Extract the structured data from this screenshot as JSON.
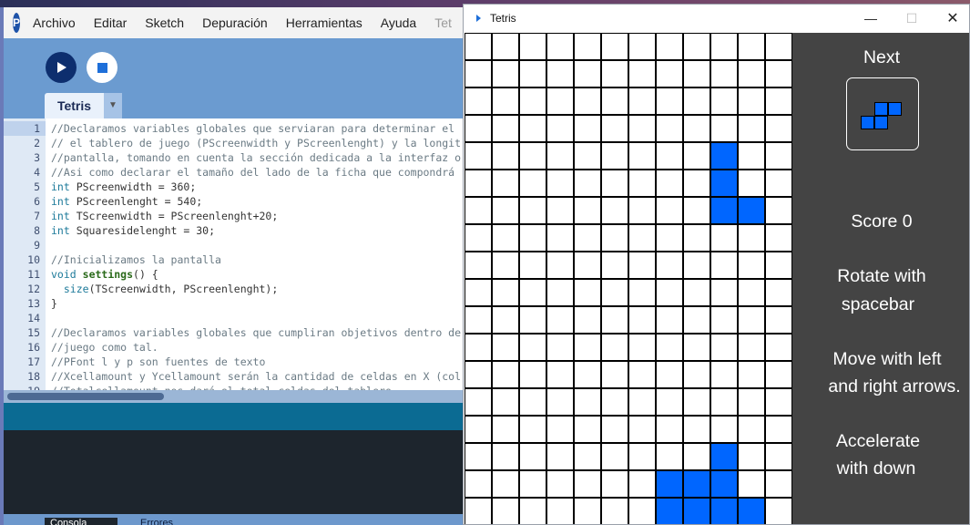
{
  "ide": {
    "menu": [
      "Archivo",
      "Editar",
      "Sketch",
      "Depuración",
      "Herramientas",
      "Ayuda",
      "Tet"
    ],
    "tab_label": "Tetris",
    "tab_arrow": "▼",
    "code_lines": [
      {
        "n": "1",
        "text": "//Declaramos variables globales que serviaran para determinar el"
      },
      {
        "n": "2",
        "text": "// el tablero de juego (PScreenwidth y PScreenlenght) y la longit"
      },
      {
        "n": "3",
        "text": "//pantalla, tomando en cuenta la sección dedicada a la interfaz o"
      },
      {
        "n": "4",
        "text": "//Asi como declarar el tamaño del lado de la ficha que compondrá"
      },
      {
        "n": "5",
        "text": "int PScreenwidth = 360;"
      },
      {
        "n": "6",
        "text": "int PScreenlenght = 540;"
      },
      {
        "n": "7",
        "text": "int TScreenwidth = PScreenlenght+20;"
      },
      {
        "n": "8",
        "text": "int Squaresidelenght = 30;"
      },
      {
        "n": "9",
        "text": ""
      },
      {
        "n": "10",
        "text": "//Inicializamos la pantalla"
      },
      {
        "n": "11",
        "text": "void settings() {"
      },
      {
        "n": "12",
        "text": "  size(TScreenwidth, PScreenlenght);"
      },
      {
        "n": "13",
        "text": "}"
      },
      {
        "n": "14",
        "text": ""
      },
      {
        "n": "15",
        "text": "//Declaramos variables globales que cumpliran objetivos dentro de"
      },
      {
        "n": "16",
        "text": "//juego como tal."
      },
      {
        "n": "17",
        "text": "//PFont l y p son fuentes de texto"
      },
      {
        "n": "18",
        "text": "//Xcellamount y Ycellamount serán la cantidad de celdas en X (col"
      },
      {
        "n": "19",
        "text": "//Totalcellamount nos dará el total celdas del tablero"
      }
    ],
    "console_tabs": [
      "Consola",
      "Errores"
    ]
  },
  "sketch": {
    "title": "Tetris",
    "controls": {
      "minimize": "—",
      "maximize": "☐",
      "close": "✕"
    },
    "board": {
      "cols": 12,
      "rows": 18,
      "filled_cells": [
        [
          9,
          4
        ],
        [
          9,
          5
        ],
        [
          9,
          6
        ],
        [
          10,
          6
        ],
        [
          9,
          15
        ],
        [
          7,
          16
        ],
        [
          8,
          16
        ],
        [
          9,
          16
        ],
        [
          7,
          17
        ],
        [
          8,
          17
        ],
        [
          9,
          17
        ],
        [
          10,
          17
        ]
      ]
    },
    "side": {
      "next_label": "Next",
      "score_label": "Score 0",
      "rotate_line1": "Rotate with",
      "rotate_line2": "spacebar",
      "move_line1": "Move with left",
      "move_line2": "and right arrows.",
      "accel_line1": "Accelerate",
      "accel_line2": "with down"
    },
    "next_piece": "S",
    "piece_color": "#0066ff",
    "panel_color": "#444444"
  }
}
